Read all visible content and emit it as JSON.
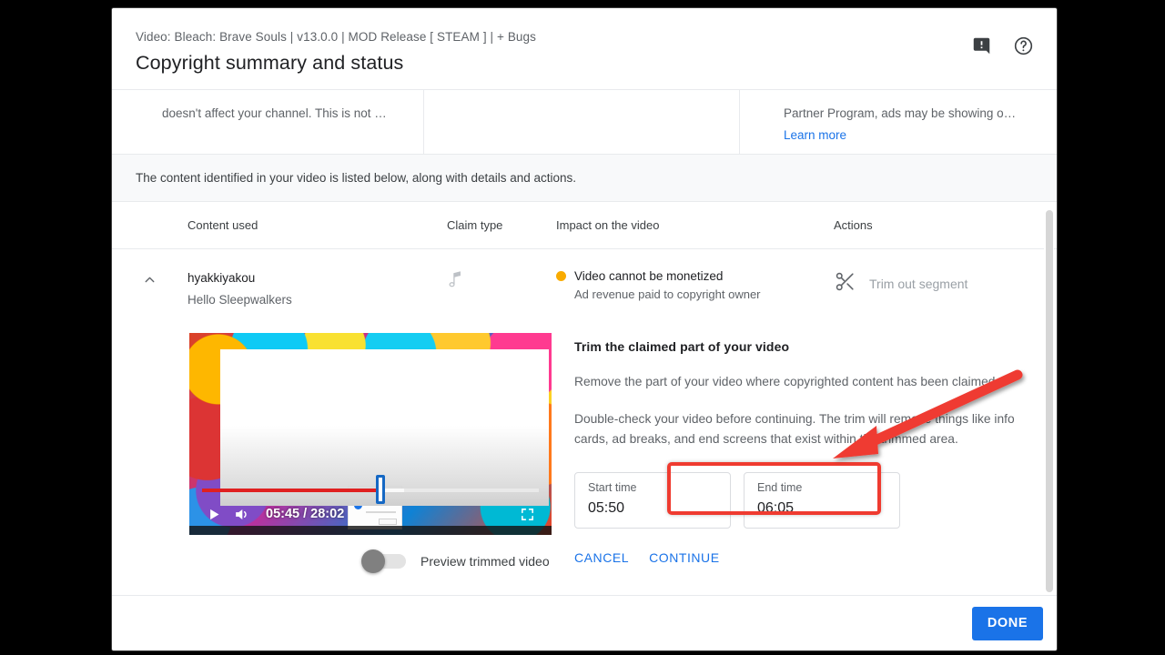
{
  "dialog": {
    "subtitle": "Video: Bleach: Brave Souls | v13.0.0 | MOD Release [ STEAM ] | + Bugs",
    "title": "Copyright summary and status",
    "feedback_icon": "feedback-icon",
    "help_icon": "help-icon"
  },
  "summary": {
    "cell1_text": "doesn't affect your channel. This is not …",
    "cell2_text": "",
    "cell3_text": "Partner Program, ads may be showing o…",
    "learn_more": "Learn more"
  },
  "notice": {
    "text": "The content identified in your video is listed below, along with details and actions."
  },
  "table": {
    "headers": {
      "content_used": "Content used",
      "claim_type": "Claim type",
      "impact": "Impact on the video",
      "actions": "Actions"
    },
    "row": {
      "content_title": "hyakkiyakou",
      "content_sub": "Hello Sleepwalkers",
      "claim_type_icon": "music-note-icon",
      "impact_primary": "Video cannot be monetized",
      "impact_secondary": "Ad revenue paid to copyright owner",
      "impact_dot_color": "#f9ab00",
      "action_label": "Trim out segment",
      "action_icon": "scissors-icon",
      "expand_icon": "chevron-up-icon"
    },
    "highlight_color": "#ef3b30"
  },
  "player": {
    "current_time": "05:45",
    "total_time": "28:02",
    "time_readout": "05:45 / 28:02",
    "play_icon": "play-icon",
    "volume_icon": "volume-icon",
    "fullscreen_icon": "fullscreen-icon"
  },
  "toggle": {
    "label": "Preview trimmed video",
    "state": "off"
  },
  "trim": {
    "heading": "Trim the claimed part of your video",
    "paragraph1": "Remove the part of your video where copyrighted content has been claimed",
    "paragraph2": "Double-check your video before continuing. The trim will remove things like info cards, ad breaks, and end screens that exist within the trimmed area.",
    "start_label": "Start time",
    "start_value": "05:50",
    "end_label": "End time",
    "end_value": "06:05",
    "cancel": "CANCEL",
    "continue": "CONTINUE"
  },
  "footer": {
    "done": "DONE",
    "accent_color": "#1a73e8"
  }
}
